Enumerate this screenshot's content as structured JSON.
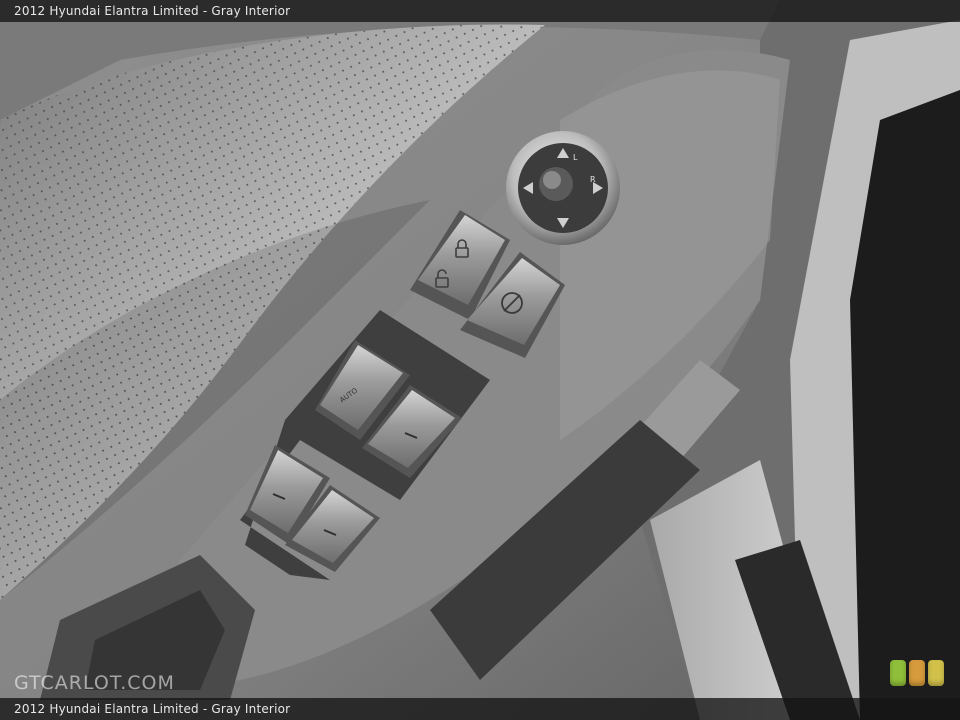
{
  "caption": {
    "top": "2012 Hyundai Elantra Limited - Gray Interior",
    "bottom": "2012 Hyundai Elantra Limited - Gray Interior"
  },
  "watermark": "GTCARLOT.COM",
  "photo": {
    "subject": "door-panel-switch-cluster",
    "palette": {
      "panel": "#8e8e8e",
      "fabric": "#b9b9b9",
      "trim": "#6f6f6f",
      "switch": "#7a7a7a",
      "chrome": "#d8d8d8"
    },
    "switch_labels": {
      "auto": "AUTO"
    }
  },
  "badge_colors": [
    "#8fbf3a",
    "#d69b3c",
    "#d1c14a"
  ]
}
